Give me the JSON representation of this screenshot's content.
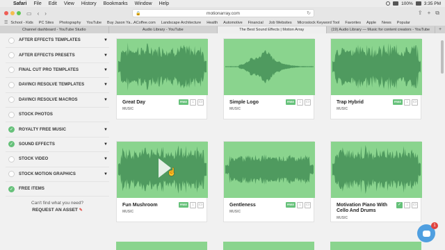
{
  "menubar": {
    "apple": "",
    "items": [
      "Safari",
      "File",
      "Edit",
      "View",
      "History",
      "Bookmarks",
      "Window",
      "Help"
    ],
    "battery": "100%",
    "clock": "3:35 PM"
  },
  "toolbar": {
    "url": "motionarray.com",
    "back": "‹",
    "forward": "›",
    "sidebar_toggle": "▭",
    "share": "⇪",
    "reload": "↻"
  },
  "bookmarks": [
    "School - Kids",
    "PC Sites",
    "Photography",
    "YouTube",
    "Buy Jason Ya...ACoffee.com",
    "Landscape Architecture",
    "Health",
    "Automotive",
    "Financial",
    "Job Websites",
    "Microstock Keyword Tool",
    "Favorites",
    "Apple",
    "News",
    "Popular"
  ],
  "tabs": [
    {
      "label": "Channel dashboard - YouTube Studio",
      "active": false
    },
    {
      "label": "Audio Library - YouTube",
      "active": false
    },
    {
      "label": "The Best Sound Effects | Motion Array",
      "active": true
    },
    {
      "label": "(19) Audio Library — Music for content creators - YouTube",
      "active": false
    }
  ],
  "sidebar": {
    "filters": [
      {
        "label": "AFTER EFFECTS TEMPLATES",
        "checked": false
      },
      {
        "label": "AFTER EFFECTS PRESETS",
        "checked": false
      },
      {
        "label": "FINAL CUT PRO TEMPLATES",
        "checked": false
      },
      {
        "label": "DAVINCI RESOLVE TEMPLATES",
        "checked": false
      },
      {
        "label": "DAVINCI RESOLVE MACROS",
        "checked": false
      },
      {
        "label": "STOCK PHOTOS",
        "checked": false
      },
      {
        "label": "ROYALTY FREE MUSIC",
        "checked": true
      },
      {
        "label": "SOUND EFFECTS",
        "checked": true
      },
      {
        "label": "STOCK VIDEO",
        "checked": false
      },
      {
        "label": "STOCK MOTION GRAPHICS",
        "checked": false
      },
      {
        "label": "FREE ITEMS",
        "checked": true
      }
    ],
    "cant_find": "Can't find what you need?",
    "request": "REQUEST AN ASSET"
  },
  "cards": [
    {
      "title": "Great Day",
      "category": "MUSIC",
      "badge": "FREE",
      "wave": "full"
    },
    {
      "title": "Simple Logo",
      "category": "MUSIC",
      "badge": "FREE",
      "wave": "short"
    },
    {
      "title": "Trap Hybrid",
      "category": "MUSIC",
      "badge": "FREE",
      "wave": "full"
    },
    {
      "title": "Fun Mushroom",
      "category": "MUSIC",
      "badge": "FREE",
      "wave": "full"
    },
    {
      "title": "Gentleness",
      "category": "MUSIC",
      "badge": "FREE",
      "wave": "flat"
    },
    {
      "title": "Motivation Piano With Cello And Drums",
      "category": "MUSIC",
      "badge": "FREE",
      "wave": "full"
    }
  ],
  "chat": {
    "count": "1"
  },
  "colors": {
    "accent": "#66c17a",
    "wave_bg": "#8ad48e",
    "wave_fg": "#4f9a5f"
  }
}
